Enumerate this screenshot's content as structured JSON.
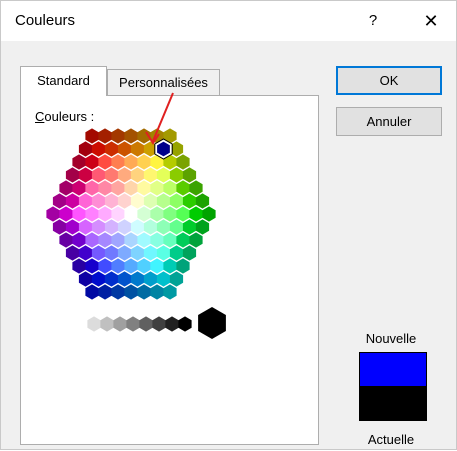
{
  "window": {
    "title": "Couleurs",
    "help_label": "?",
    "close_label": "✕"
  },
  "tabs": [
    {
      "label": "Standard",
      "active": true
    },
    {
      "label": "Personnalisées",
      "active": false
    }
  ],
  "panel": {
    "label_accel": "C",
    "label_rest": "ouleurs :"
  },
  "buttons": {
    "ok_label": "OK",
    "cancel_label": "Annuler"
  },
  "preview": {
    "new_label": "Nouvelle",
    "current_label": "Actuelle",
    "new_color": "#0000ff",
    "current_color": "#000000"
  },
  "palette": {
    "selected_color": "#00008b",
    "grays": [
      "#ffffff",
      "#dcdcdc",
      "#c0c0c0",
      "#a0a0a0",
      "#808080",
      "#606060",
      "#404040",
      "#202020",
      "#000000"
    ]
  },
  "annotation": {
    "arrow_color": "#e02020"
  }
}
